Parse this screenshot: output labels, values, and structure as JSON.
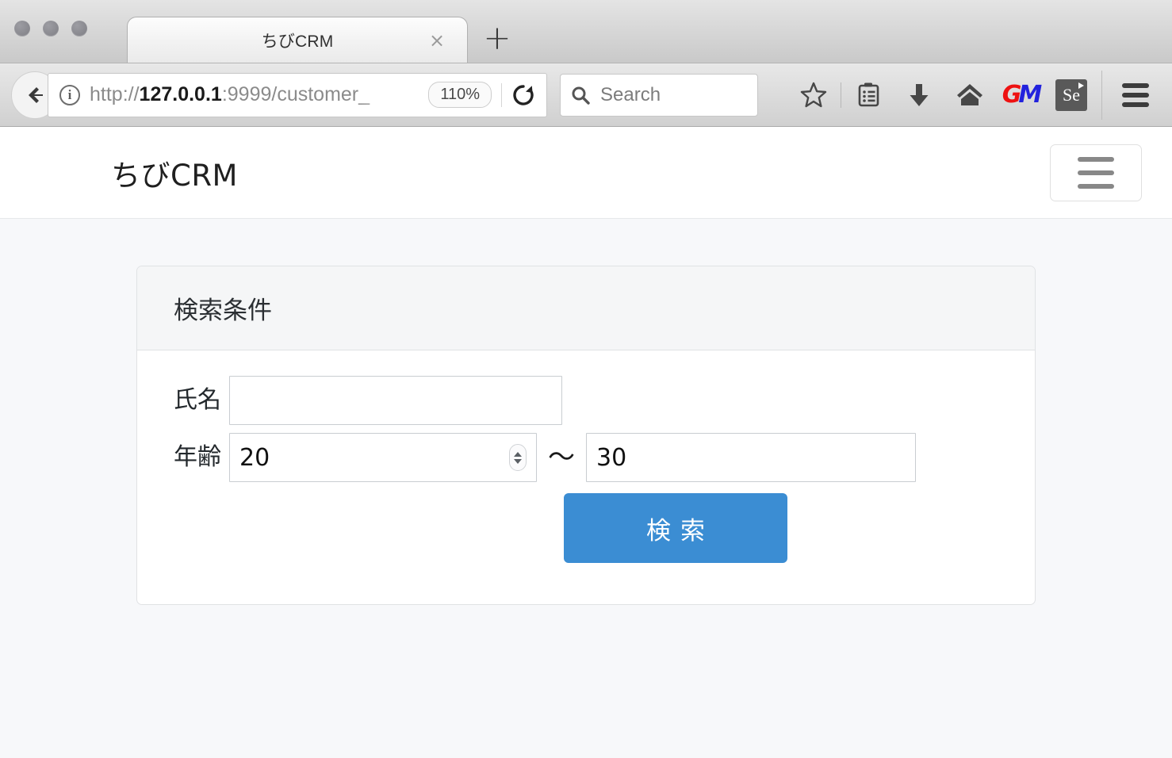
{
  "browser": {
    "window_controls": [
      "close",
      "minimize",
      "zoom"
    ],
    "tab": {
      "title": "ちびCRM",
      "close_label": "×"
    },
    "new_tab_label": "+",
    "back_label": "←",
    "address_bar": {
      "info_icon": "info-icon",
      "url_scheme": "http://",
      "url_host": "127.0.0.1",
      "url_rest": ":9999/customer_",
      "zoom_level": "110%",
      "reload_label": "⟳"
    },
    "search_box": {
      "placeholder": "Search",
      "icon": "search-icon"
    },
    "toolbar_icons": [
      {
        "name": "bookmark-star-icon",
        "label": "☆"
      },
      {
        "name": "reader-list-icon",
        "label": "▤"
      },
      {
        "name": "downloads-icon",
        "label": "⬇"
      },
      {
        "name": "home-icon",
        "label": "⌂"
      },
      {
        "name": "greasemonkey-icon",
        "label": "GM"
      },
      {
        "name": "selenium-ide-icon",
        "label": "Se"
      },
      {
        "name": "chrome-menu-icon",
        "label": "≡"
      }
    ]
  },
  "page": {
    "navbar": {
      "brand": "ちびCRM",
      "toggle_label": "メニュー"
    },
    "panel": {
      "title": "検索条件",
      "form": {
        "name_field": {
          "label": "氏名",
          "value": "",
          "placeholder": ""
        },
        "age_from_field": {
          "label": "年齢",
          "value": "20"
        },
        "range_separator": "〜",
        "age_to_field": {
          "value": "30"
        },
        "submit_label": "検索"
      }
    }
  },
  "colors": {
    "primary": "#3b8dd3",
    "page_background": "#f7f8fa",
    "panel_header": "#f5f6f7",
    "panel_border": "#e0e2e4",
    "text": "#23282c"
  }
}
